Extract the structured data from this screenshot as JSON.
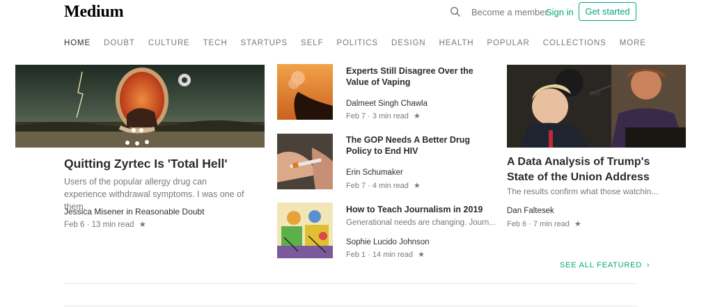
{
  "header": {
    "logo": "Medium",
    "search_icon": "search-icon",
    "become_member": "Become a member",
    "sign_in": "Sign in",
    "get_started": "Get started"
  },
  "nav": {
    "items": [
      "HOME",
      "DOUBT",
      "CULTURE",
      "TECH",
      "STARTUPS",
      "SELF",
      "POLITICS",
      "DESIGN",
      "HEALTH",
      "POPULAR",
      "COLLECTIONS",
      "MORE"
    ],
    "active": "HOME"
  },
  "featured_left": {
    "title": "Quitting Zyrtec Is 'Total Hell'",
    "subtitle": "Users of the popular allergy drug can experience withdrawal symptoms. I was one of them.",
    "author": "Jessica Misener in Reasonable Doubt",
    "meta": "Feb 6 · 13 min read",
    "star": "★"
  },
  "list": [
    {
      "title": "Experts Still Disagree Over the Value of Vaping",
      "author": "Dalmeet Singh Chawla",
      "meta": "Feb 7 · 3 min read",
      "star": "★"
    },
    {
      "title": "The GOP Needs A Better Drug Policy to End HIV",
      "author": "Erin Schumaker",
      "meta": "Feb 7 · 4 min read",
      "star": "★"
    },
    {
      "title": "How to Teach Journalism in 2019",
      "subtitle": "Generational needs are changing. Journ...",
      "author": "Sophie Lucido Johnson",
      "meta": "Feb 1 · 14 min read",
      "star": "★"
    }
  ],
  "featured_right": {
    "title": "A Data Analysis of Trump's State of the Union Address",
    "subtitle": "The results confirm what those watchin...",
    "author": "Dan Faltesek",
    "meta": "Feb 6 · 7 min read",
    "star": "★"
  },
  "see_all": "SEE ALL FEATURED",
  "see_all_chevron": "›",
  "colors": {
    "accent": "#03a87c"
  }
}
